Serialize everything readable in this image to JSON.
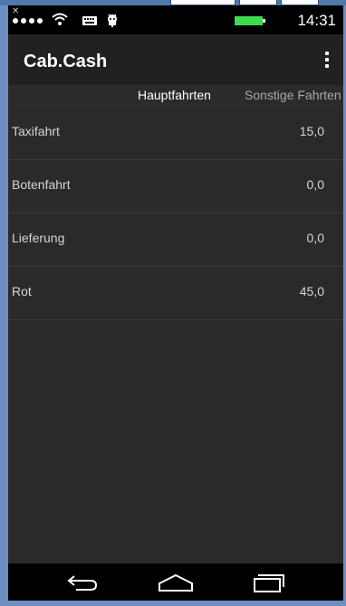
{
  "statusbar": {
    "time": "14:31",
    "icons": [
      "close-x-icon",
      "signal-dots-icon",
      "wifi-icon",
      "keyboard-icon",
      "android-debug-icon",
      "battery-icon"
    ],
    "battery_color": "#3ddc50"
  },
  "appbar": {
    "title": "Cab.Cash",
    "menu_icon": "overflow-menu-icon"
  },
  "tabs": [
    {
      "label": "Hauptfahrten",
      "active": true
    },
    {
      "label": "Sonstige Fahrten",
      "active": false
    }
  ],
  "rows": [
    {
      "label": "Taxifahrt",
      "value": "15,0"
    },
    {
      "label": "Botenfahrt",
      "value": "0,0"
    },
    {
      "label": "Lieferung",
      "value": "0,0"
    },
    {
      "label": "Rot",
      "value": "45,0"
    }
  ],
  "navbar": {
    "icons": [
      "back-icon",
      "home-icon",
      "recent-apps-icon"
    ]
  },
  "colors": {
    "background": "#2a292c",
    "appbar": "#212121",
    "statusbar": "#000000",
    "text": "#d6d6d6",
    "tab_inactive": "#a9a9a9"
  }
}
